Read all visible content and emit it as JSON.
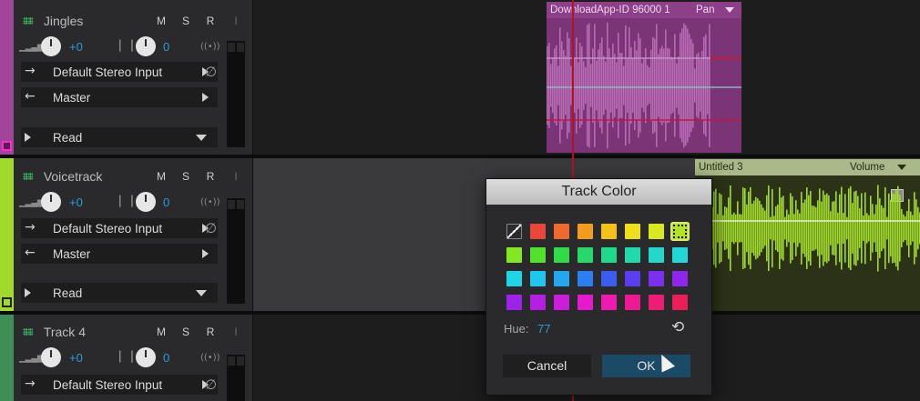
{
  "colors": {
    "accent": "#2b9bd8",
    "jingles": "#a0469a",
    "voicetrack": "#a2da2c",
    "track4": "#3d8f55",
    "playhead": "#b3102a"
  },
  "tracks": [
    {
      "name": "Jingles",
      "mute": "M",
      "solo": "S",
      "record": "R",
      "input_monitor": "I",
      "volume": "+0",
      "pan": "0",
      "input": "Default Stereo Input",
      "output": "Master",
      "automation": "Read",
      "icons": [
        "waveform-icon",
        "volume-icon",
        "pan-icon",
        "broadcast-icon",
        "phase-icon"
      ]
    },
    {
      "name": "Voicetrack",
      "mute": "M",
      "solo": "S",
      "record": "R",
      "input_monitor": "I",
      "volume": "+0",
      "pan": "0",
      "input": "Default Stereo Input",
      "output": "Master",
      "automation": "Read"
    },
    {
      "name": "Track 4",
      "mute": "M",
      "solo": "S",
      "record": "R",
      "input_monitor": "I",
      "volume": "+0",
      "pan": "0",
      "input": "Default Stereo Input"
    }
  ],
  "clips": [
    {
      "title": "DownloadApp-ID 96000 1",
      "mode": "Pan"
    },
    {
      "title": "Untitled 3",
      "mode": "Volume"
    }
  ],
  "dialog": {
    "title": "Track Color",
    "hue_label": "Hue:",
    "hue_value": "77",
    "cancel": "Cancel",
    "ok": "OK",
    "swatch_colors": [
      "none",
      "#e8473a",
      "#ef6a2c",
      "#f39b1f",
      "#f5c018",
      "#eedf1a",
      "#d8ea1d",
      "#b4e322",
      "#82e81f",
      "#52e22c",
      "#2fdc46",
      "#27d86a",
      "#1fda8c",
      "#1edbac",
      "#22d8c8",
      "#1fd8d8",
      "#1ed6e6",
      "#1fc6ee",
      "#24a6f0",
      "#2b7ff2",
      "#3a5cf0",
      "#5a3ef0",
      "#7b2ff0",
      "#8f26ee",
      "#9f22ec",
      "#b51fe4",
      "#cc1ddc",
      "#e51acf",
      "#ee1ab0",
      "#ef1a93",
      "#ee1c73",
      "#eb1e5a"
    ],
    "selected_index": 7
  }
}
